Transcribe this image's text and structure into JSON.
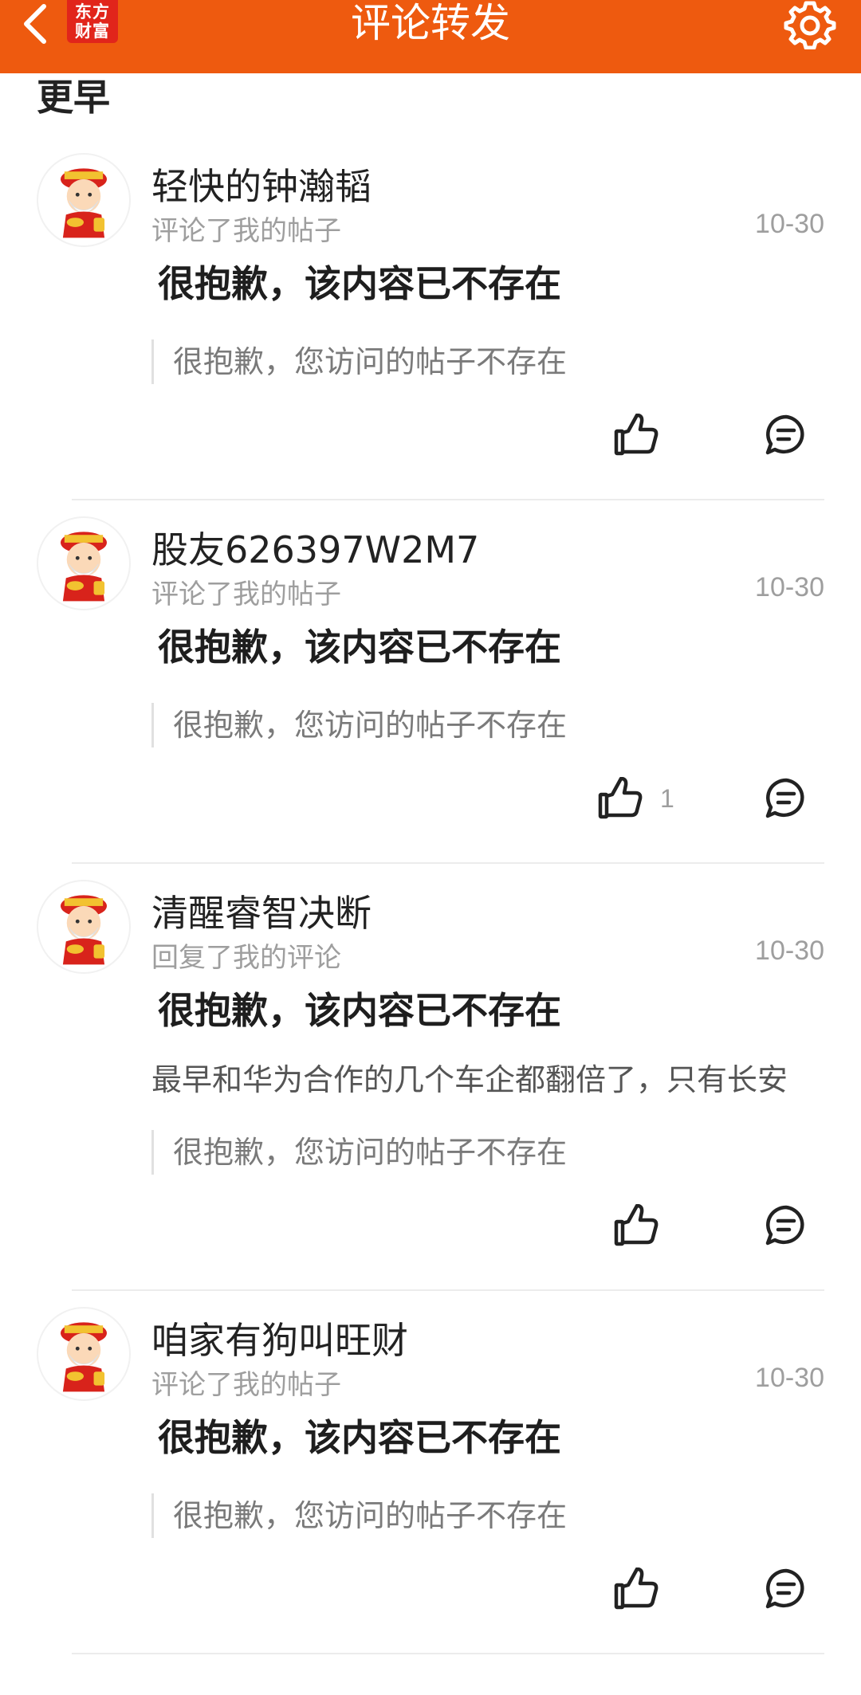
{
  "header": {
    "title": "评论转发",
    "logo_line1": "东方",
    "logo_line2": "财富",
    "accent": "#ee5a0f"
  },
  "section_title": "更早",
  "items": [
    {
      "name": "轻快的钟瀚韬",
      "action": "评论了我的帖子",
      "time": "10-30",
      "content": "很抱歉，该内容已不存在",
      "quote": "很抱歉，您访问的帖子不存在",
      "likes": ""
    },
    {
      "name": "股友626397W2M7",
      "action": "评论了我的帖子",
      "time": "10-30",
      "content": "很抱歉，该内容已不存在",
      "quote": "很抱歉，您访问的帖子不存在",
      "likes": "1"
    },
    {
      "name": "清醒睿智决断",
      "action": "回复了我的评论",
      "time": "10-30",
      "content": "很抱歉，该内容已不存在",
      "extra": "最早和华为合作的几个车企都翻倍了，只有长安",
      "quote": "很抱歉，您访问的帖子不存在",
      "likes": ""
    },
    {
      "name": "咱家有狗叫旺财",
      "action": "评论了我的帖子",
      "time": "10-30",
      "content": "很抱歉，该内容已不存在",
      "quote": "很抱歉，您访问的帖子不存在",
      "likes": ""
    }
  ],
  "icons": {
    "back": "chevron-left-icon",
    "settings": "gear-icon",
    "like": "thumbs-up-icon",
    "reply": "chat-bubble-icon",
    "avatar": "fortune-god-avatar"
  }
}
